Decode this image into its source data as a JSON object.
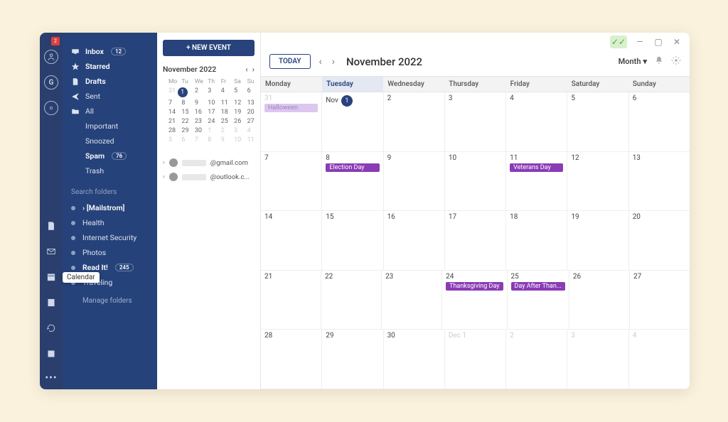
{
  "iconbar": {
    "notification_count": "2",
    "tooltip_calendar": "Calendar"
  },
  "sidebar": {
    "items": [
      {
        "kind": "inbox",
        "label": "Inbox",
        "count": "12",
        "bold": true
      },
      {
        "kind": "star",
        "label": "Starred",
        "bold": true
      },
      {
        "kind": "file",
        "label": "Drafts",
        "bold": true
      },
      {
        "kind": "send",
        "label": "Sent"
      },
      {
        "kind": "folder",
        "label": "All"
      },
      {
        "kind": "noicon",
        "label": "Important"
      },
      {
        "kind": "noicon",
        "label": "Snoozed"
      },
      {
        "kind": "noicon",
        "label": "Spam",
        "count": "76",
        "bold": true
      },
      {
        "kind": "noicon",
        "label": "Trash"
      }
    ],
    "search_folders_label": "Search folders",
    "folders": [
      {
        "label": "› [Mailstrom]",
        "bold": true
      },
      {
        "label": "Health"
      },
      {
        "label": "Internet Security"
      },
      {
        "label": "Photos"
      },
      {
        "label": "Read It!",
        "count": "245",
        "bold": true
      },
      {
        "label": "Traveling"
      }
    ],
    "manage_label": "Manage folders"
  },
  "midpanel": {
    "new_event": "+ NEW EVENT",
    "mini_title": "November 2022",
    "weekdays": [
      "Mo",
      "Tu",
      "We",
      "Th",
      "Fr",
      "Sa",
      "Su"
    ],
    "weeks": [
      [
        {
          "n": "31",
          "dim": true
        },
        {
          "n": "1",
          "today": true
        },
        {
          "n": "2"
        },
        {
          "n": "3"
        },
        {
          "n": "4"
        },
        {
          "n": "5"
        },
        {
          "n": "6"
        }
      ],
      [
        {
          "n": "7"
        },
        {
          "n": "8"
        },
        {
          "n": "9"
        },
        {
          "n": "10"
        },
        {
          "n": "11"
        },
        {
          "n": "12"
        },
        {
          "n": "13"
        }
      ],
      [
        {
          "n": "14"
        },
        {
          "n": "15"
        },
        {
          "n": "16"
        },
        {
          "n": "17"
        },
        {
          "n": "18"
        },
        {
          "n": "19"
        },
        {
          "n": "20"
        }
      ],
      [
        {
          "n": "21"
        },
        {
          "n": "22"
        },
        {
          "n": "23"
        },
        {
          "n": "24"
        },
        {
          "n": "25"
        },
        {
          "n": "26"
        },
        {
          "n": "27"
        }
      ],
      [
        {
          "n": "28"
        },
        {
          "n": "29"
        },
        {
          "n": "30"
        },
        {
          "n": "1",
          "dim": true
        },
        {
          "n": "2",
          "dim": true
        },
        {
          "n": "3",
          "dim": true
        },
        {
          "n": "4",
          "dim": true
        }
      ],
      [
        {
          "n": "5",
          "dim": true
        },
        {
          "n": "6",
          "dim": true
        },
        {
          "n": "7",
          "dim": true
        },
        {
          "n": "8",
          "dim": true
        },
        {
          "n": "9",
          "dim": true
        },
        {
          "n": "10",
          "dim": true
        },
        {
          "n": "11",
          "dim": true
        }
      ]
    ],
    "accounts": [
      {
        "domain": "@gmail.com"
      },
      {
        "domain": "@outlook.c..."
      }
    ]
  },
  "main": {
    "today_btn": "TODAY",
    "title": "November 2022",
    "view": "Month",
    "weekdays": [
      "Monday",
      "Tuesday",
      "Wednesday",
      "Thursday",
      "Friday",
      "Saturday",
      "Sunday"
    ],
    "today_index": 1,
    "rows": [
      [
        {
          "d": "31",
          "dim": true,
          "events": [
            {
              "t": "Halloween",
              "cls": "lav-fade"
            }
          ]
        },
        {
          "d": "1",
          "today": true,
          "prefix": "Nov"
        },
        {
          "d": "2"
        },
        {
          "d": "3"
        },
        {
          "d": "4"
        },
        {
          "d": "5"
        },
        {
          "d": "6"
        }
      ],
      [
        {
          "d": "7"
        },
        {
          "d": "8",
          "events": [
            {
              "t": "Election Day",
              "cls": "purple"
            }
          ]
        },
        {
          "d": "9"
        },
        {
          "d": "10"
        },
        {
          "d": "11",
          "events": [
            {
              "t": "Veterans Day",
              "cls": "purple"
            }
          ]
        },
        {
          "d": "12"
        },
        {
          "d": "13"
        }
      ],
      [
        {
          "d": "14"
        },
        {
          "d": "15"
        },
        {
          "d": "16"
        },
        {
          "d": "17"
        },
        {
          "d": "18"
        },
        {
          "d": "19"
        },
        {
          "d": "20"
        }
      ],
      [
        {
          "d": "21"
        },
        {
          "d": "22"
        },
        {
          "d": "23"
        },
        {
          "d": "24",
          "events": [
            {
              "t": "Thanksgiving Day",
              "cls": "purple"
            }
          ]
        },
        {
          "d": "25",
          "events": [
            {
              "t": "Day After Than...",
              "cls": "purple"
            }
          ]
        },
        {
          "d": "26"
        },
        {
          "d": "27"
        }
      ],
      [
        {
          "d": "28"
        },
        {
          "d": "29"
        },
        {
          "d": "30"
        },
        {
          "d": "Dec 1",
          "dim": true
        },
        {
          "d": "2",
          "dim": true
        },
        {
          "d": "3",
          "dim": true
        },
        {
          "d": "4",
          "dim": true
        }
      ]
    ]
  }
}
